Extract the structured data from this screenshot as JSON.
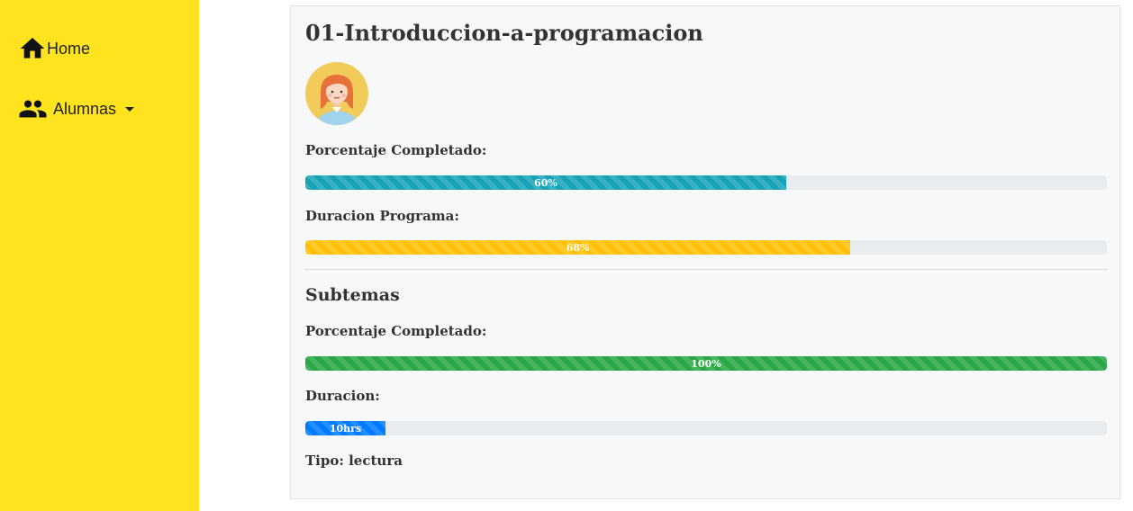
{
  "sidebar": {
    "bg_color": "#ffe31f",
    "items": [
      {
        "label": "Home",
        "icon": "home-icon"
      },
      {
        "label": "Alumnas",
        "icon": "people-icon",
        "has_dropdown": true
      }
    ]
  },
  "course": {
    "title": "01-Introduccion-a-programacion",
    "avatar": "girl-avatar",
    "porcentaje_label": "Porcentaje Completado:",
    "porcentaje": {
      "text": "60%",
      "value": 60,
      "color": "#17a2b8"
    },
    "duracion_label": "Duracion Programa:",
    "duracion": {
      "text": "68%",
      "value": 68,
      "color": "#ffc107"
    }
  },
  "subtemas": {
    "title": "Subtemas",
    "porcentaje_label": "Porcentaje Completado:",
    "porcentaje": {
      "text": "100%",
      "value": 100,
      "color": "#28a745"
    },
    "duracion_label": "Duracion:",
    "duracion": {
      "text": "10hrs",
      "value": 10,
      "color": "#007bff"
    },
    "tipo": "Tipo: lectura"
  }
}
